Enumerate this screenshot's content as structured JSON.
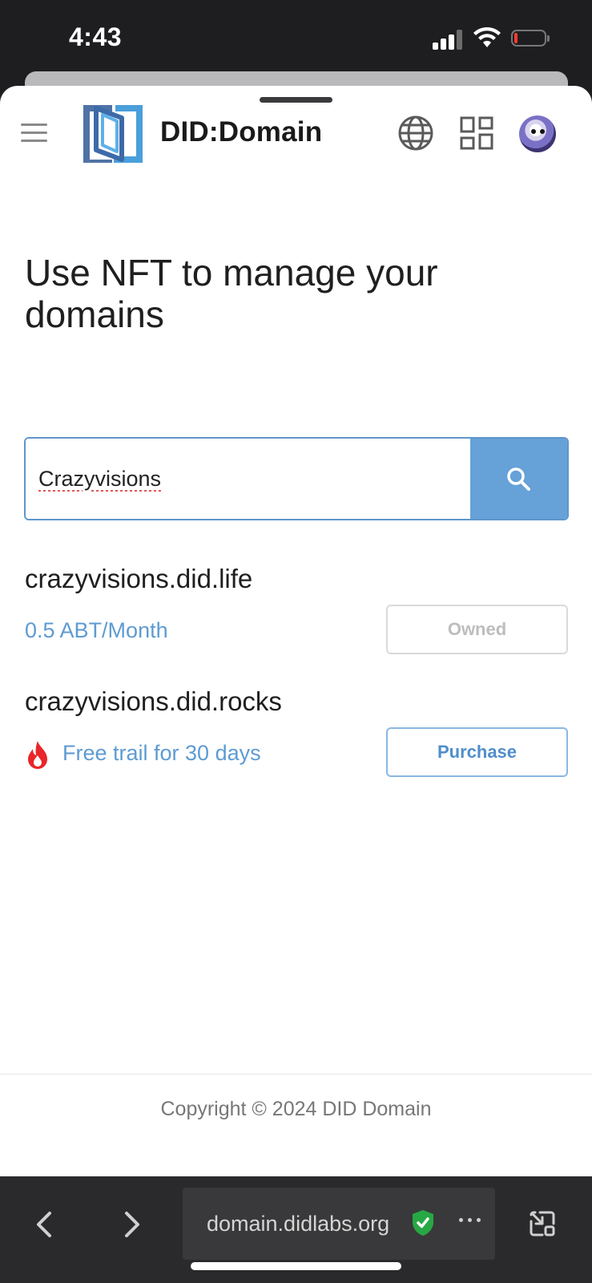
{
  "status_bar": {
    "time": "4:43"
  },
  "header": {
    "brand": "DID:Domain",
    "icons": [
      "hamburger-menu-icon",
      "did-logo-icon",
      "globe-icon",
      "apps-grid-icon",
      "avatar"
    ]
  },
  "hero": {
    "title": "Use NFT to manage your domains"
  },
  "search": {
    "value": "Crazyvisions"
  },
  "results": [
    {
      "domain": "crazyvisions.did.life",
      "price": "0.5 ABT/Month",
      "action": "Owned"
    },
    {
      "domain": "crazyvisions.did.rocks",
      "offer": "Free trail for 30 days",
      "action": "Purchase"
    }
  ],
  "footer": {
    "copyright": "Copyright © 2024 DID Domain"
  },
  "browser": {
    "url": "domain.didlabs.org"
  },
  "colors": {
    "accent_blue": "#66a1d8",
    "link_blue": "#5e9bd2",
    "fire_red": "#e8262a",
    "secure_green": "#27a844"
  }
}
